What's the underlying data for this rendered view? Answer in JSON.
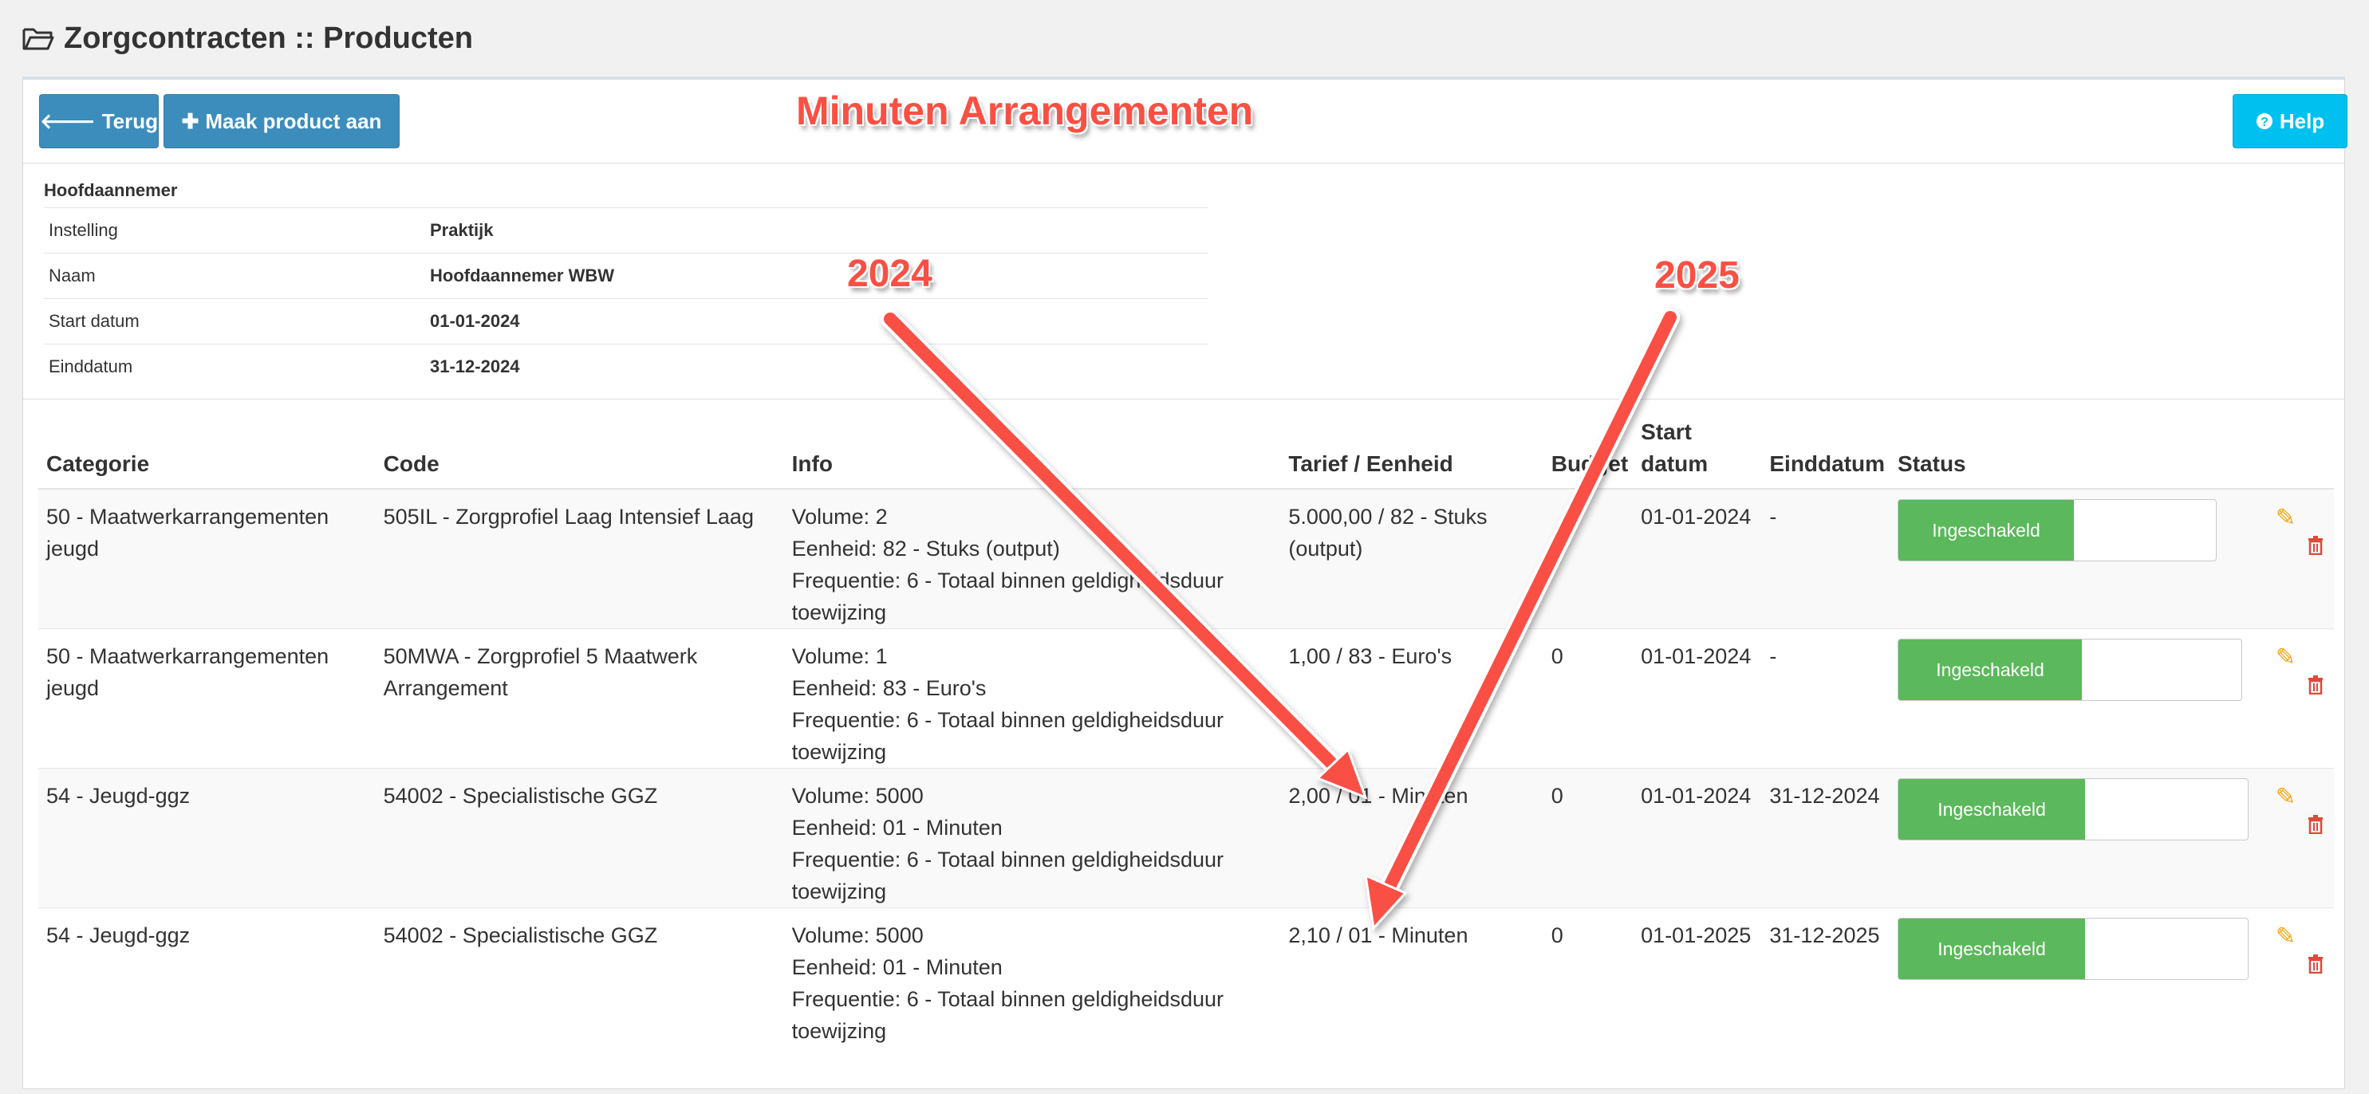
{
  "page": {
    "title": "Zorgcontracten :: Producten"
  },
  "toolbar": {
    "back_label": "Terug",
    "create_label": "Maak product aan",
    "help_label": "Help"
  },
  "annotations": {
    "title": "Minuten Arrangementen",
    "label_2024": "2024",
    "label_2025": "2025",
    "color": "#fa5044"
  },
  "contractor": {
    "heading": "Hoofdaannemer",
    "rows": [
      {
        "label": "Instelling",
        "value": "Praktijk"
      },
      {
        "label": "Naam",
        "value": "Hoofdaannemer WBW"
      },
      {
        "label": "Start datum",
        "value": "01-01-2024"
      },
      {
        "label": "Einddatum",
        "value": "31-12-2024"
      }
    ]
  },
  "table": {
    "headers": {
      "categorie": "Categorie",
      "code": "Code",
      "info": "Info",
      "tarief": "Tarief / Eenheid",
      "budget": "Budget",
      "start_l1": "Start",
      "start_l2": "datum",
      "einddatum": "Einddatum",
      "status": "Status"
    },
    "rows": [
      {
        "categorie": "50 - Maatwerkarrangementen jeugd",
        "code": "505IL - Zorgprofiel Laag Intensief Laag",
        "volume": "Volume: 2",
        "eenheid": "Eenheid: 82 - Stuks (output)",
        "frequentie": "Frequentie: 6 - Totaal binnen geldigheidsduur toewijzing",
        "tarief": "5.000,00 / 82 - Stuks (output)",
        "budget": "",
        "start": "01-01-2024",
        "eind": "-",
        "status": "Ingeschakeld"
      },
      {
        "categorie": "50 - Maatwerkarrangementen jeugd",
        "code": "50MWA - Zorgprofiel 5 Maatwerk Arrangement",
        "volume": "Volume: 1",
        "eenheid": "Eenheid: 83 - Euro's",
        "frequentie": "Frequentie: 6 - Totaal binnen geldigheidsduur toewijzing",
        "tarief": "1,00 / 83 - Euro's",
        "budget": "0",
        "start": "01-01-2024",
        "eind": "-",
        "status": "Ingeschakeld"
      },
      {
        "categorie": "54 - Jeugd-ggz",
        "code": "54002 - Specialistische GGZ",
        "volume": "Volume: 5000",
        "eenheid": "Eenheid: 01 - Minuten",
        "frequentie": "Frequentie: 6 - Totaal binnen geldigheidsduur toewijzing",
        "tarief": "2,00 / 01 - Minuten",
        "budget": "0",
        "start": "01-01-2024",
        "eind": "31-12-2024",
        "status": "Ingeschakeld"
      },
      {
        "categorie": "54 - Jeugd-ggz",
        "code": "54002 - Specialistische GGZ",
        "volume": "Volume: 5000",
        "eenheid": "Eenheid: 01 - Minuten",
        "frequentie": "Frequentie: 6 - Totaal binnen geldigheidsduur toewijzing",
        "tarief": "2,10 / 01 - Minuten",
        "budget": "0",
        "start": "01-01-2025",
        "eind": "31-12-2025",
        "status": "Ingeschakeld"
      }
    ]
  },
  "icons": {
    "folder": "folder-open-icon",
    "back": "arrow-left-icon",
    "create": "plus-icon",
    "help": "question-circle-icon",
    "edit": "pencil-icon",
    "delete": "trash-icon"
  },
  "colors": {
    "primary": "#3c8dbc",
    "help": "#00c0ef",
    "status_on": "#5cb85c",
    "edit": "#f0a30a",
    "delete": "#dd4b39"
  }
}
